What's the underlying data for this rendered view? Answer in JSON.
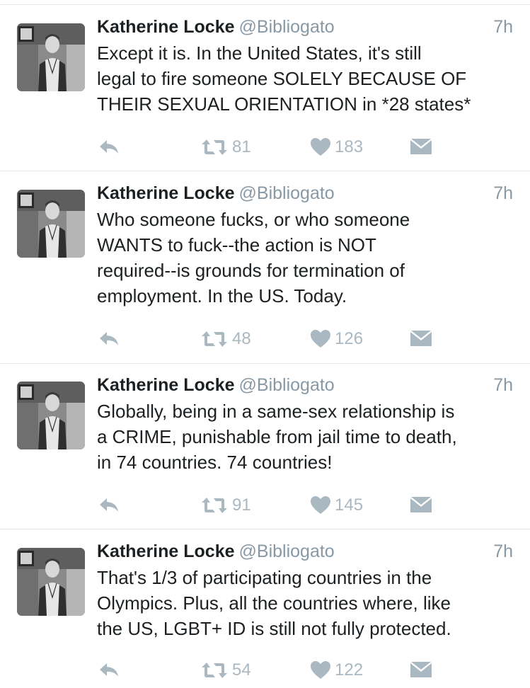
{
  "tweets": [
    {
      "name": "Katherine Locke",
      "handle": "@Bibliogato",
      "time": "7h",
      "text": "Except it is. In the United States, it's still\nlegal to fire someone SOLELY BECAUSE OF\nTHEIR SEXUAL ORIENTATION in *28 states*",
      "retweets": "81",
      "likes": "183"
    },
    {
      "name": "Katherine Locke",
      "handle": "@Bibliogato",
      "time": "7h",
      "text": "Who someone fucks, or who someone\nWANTS to fuck--the action is NOT\nrequired--is grounds for termination of\nemployment. In the US. Today.",
      "retweets": "48",
      "likes": "126"
    },
    {
      "name": "Katherine Locke",
      "handle": "@Bibliogato",
      "time": "7h",
      "text": "Globally, being in a same-sex relationship is\na CRIME, punishable from jail time to death,\nin 74 countries. 74 countries!",
      "retweets": "91",
      "likes": "145"
    },
    {
      "name": "Katherine Locke",
      "handle": "@Bibliogato",
      "time": "7h",
      "text": "That's 1/3 of participating countries in the\nOlympics. Plus, all the countries where, like\nthe US, LGBT+ ID is still not fully protected.",
      "retweets": "54",
      "likes": "122"
    }
  ],
  "icons": {
    "reply": "reply-icon",
    "retweet": "retweet-icon",
    "like": "heart-icon",
    "message": "envelope-icon"
  },
  "colors": {
    "text": "#1c2022",
    "muted": "#8899a6",
    "action": "#aab8c2",
    "divider": "#e1e8ed"
  }
}
